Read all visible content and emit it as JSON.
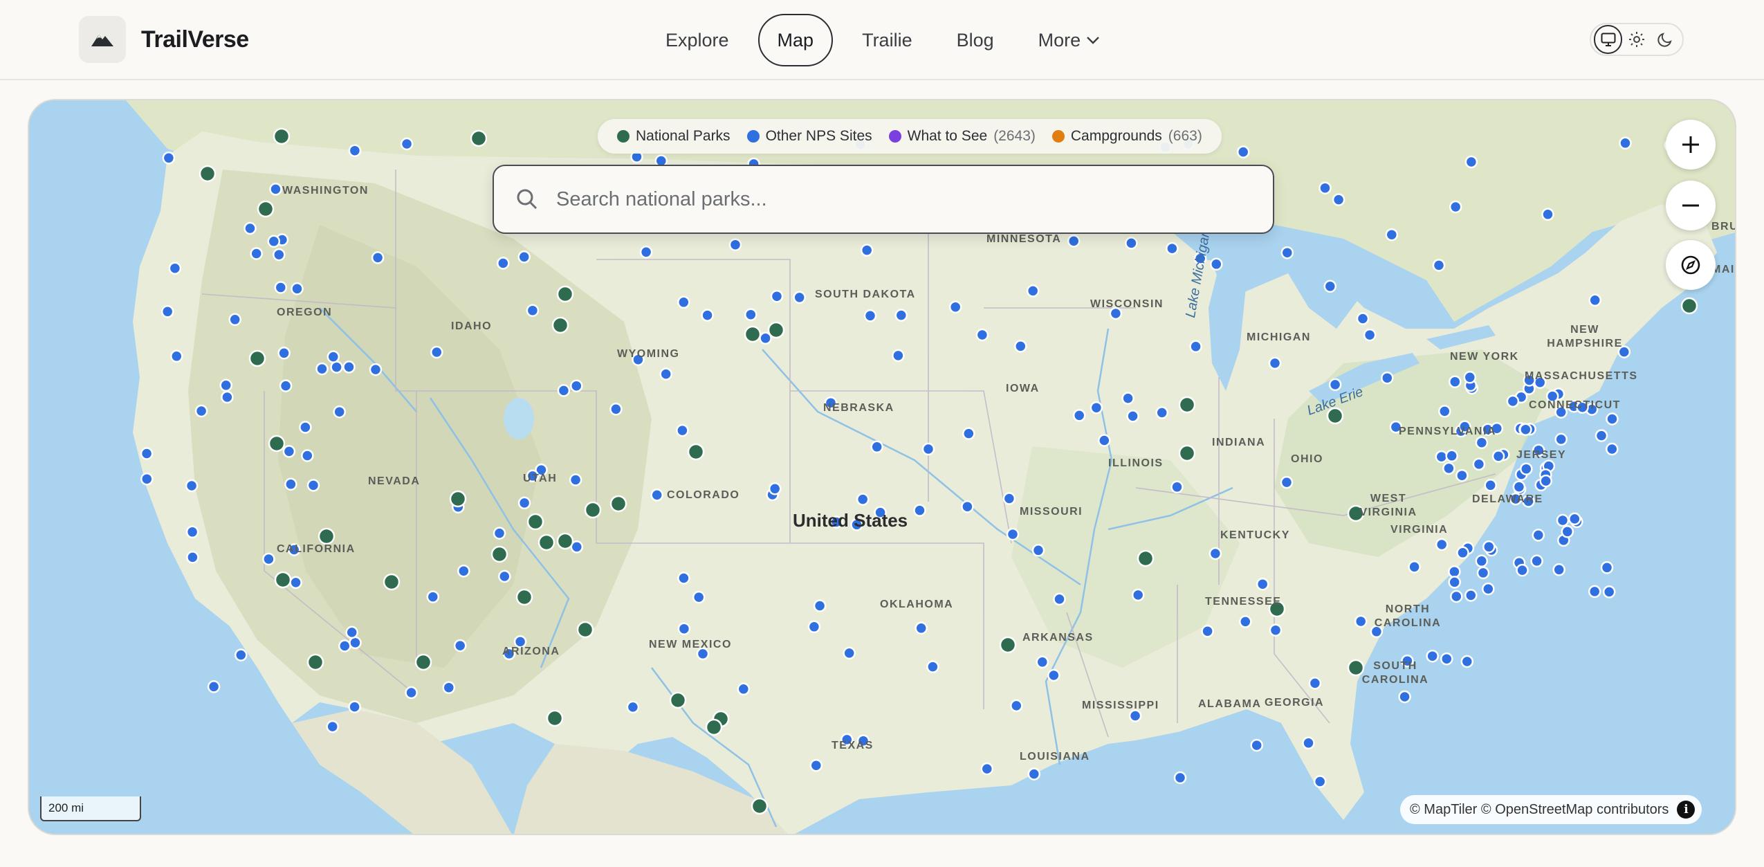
{
  "header": {
    "brand": "TrailVerse",
    "nav": [
      {
        "label": "Explore",
        "active": false
      },
      {
        "label": "Map",
        "active": true
      },
      {
        "label": "Trailie",
        "active": false
      },
      {
        "label": "Blog",
        "active": false
      },
      {
        "label": "More",
        "active": false
      }
    ],
    "theme_options": [
      "system",
      "light",
      "dark"
    ],
    "theme_selected": "system"
  },
  "legend": [
    {
      "label": "National Parks",
      "count": "",
      "color": "#2e6b4f"
    },
    {
      "label": "Other NPS Sites",
      "count": "",
      "color": "#2f6fe0"
    },
    {
      "label": "What to See",
      "count": "(2643)",
      "color": "#7b3fe0"
    },
    {
      "label": "Campgrounds",
      "count": "(663)",
      "color": "#e07e12"
    }
  ],
  "search": {
    "placeholder": "Search national parks..."
  },
  "map": {
    "country_label": "United States",
    "state_labels": [
      "WASHINGTON",
      "OREGON",
      "IDAHO",
      "WYOMING",
      "NEVADA",
      "UTAH",
      "CALIFORNIA",
      "COLORADO",
      "ARIZONA",
      "NEW MEXICO",
      "SOUTH DAKOTA",
      "NEBRASKA",
      "MINNESOTA",
      "WISCONSIN",
      "IOWA",
      "MICHIGAN",
      "ILLINOIS",
      "INDIANA",
      "OHIO",
      "MISSOURI",
      "KENTUCKY",
      "OKLAHOMA",
      "TEXAS",
      "ARKANSAS",
      "TENNESSEE",
      "MISSISSIPPI",
      "ALABAMA",
      "GEORGIA",
      "LOUISIANA",
      "SOUTH CAROLINA",
      "NORTH CAROLINA",
      "VIRGINIA",
      "WEST VIRGINIA",
      "PENNSYLVANIA",
      "NEW YORK",
      "NEW HAMPSHIRE",
      "MASSACHUSETTS",
      "CONNECTICUT",
      "JERSEY",
      "DELAWARE",
      "MAI",
      "BRUN"
    ],
    "lake_labels": [
      "Lake Michigan",
      "Lake Erie"
    ],
    "scale": "200 mi",
    "attribution": "© MapTiler © OpenStreetMap contributors",
    "controls": [
      "zoom-in",
      "zoom-out",
      "compass"
    ]
  }
}
